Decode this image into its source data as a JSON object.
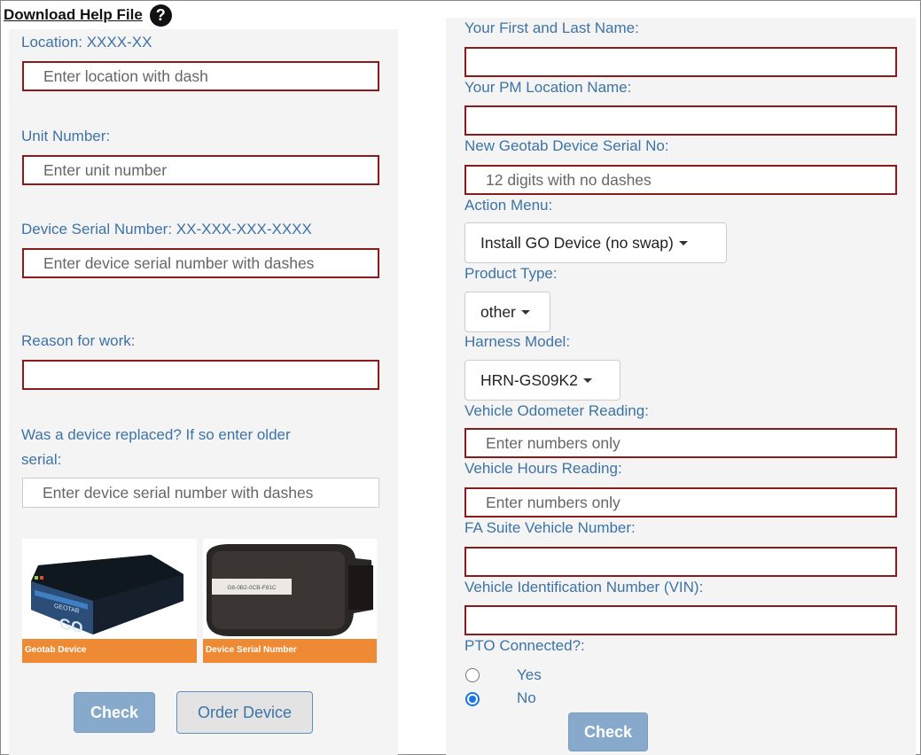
{
  "help": {
    "link_text": "Download Help File",
    "icon_glyph": "?"
  },
  "left": {
    "location_label": "Location: XXXX-XX",
    "location_placeholder": "Enter location with dash",
    "unit_label": "Unit Number:",
    "unit_placeholder": "Enter unit number",
    "serial_label": "Device Serial Number: XX-XXX-XXX-XXXX",
    "serial_placeholder": "Enter device serial number with dashes",
    "reason_label": "Reason for work:",
    "replaced_label_1": "Was a device replaced? If so enter older",
    "replaced_label_2": "serial:",
    "replaced_placeholder": "Enter device serial number with dashes",
    "image1_caption": "Geotab Device",
    "image1_brand": "GEOTAB",
    "image1_model": "GO",
    "image2_caption": "Device Serial Number",
    "image2_serial": "G8-0B2-0CB-F81C",
    "check_button": "Check",
    "order_button": "Order Device"
  },
  "right": {
    "name_label": "Your First and Last Name:",
    "pm_label": "Your PM Location Name:",
    "new_serial_label": "New Geotab Device Serial No:",
    "new_serial_placeholder": "12 digits with no dashes",
    "action_label": "Action Menu:",
    "action_value": "Install GO Device (no swap)",
    "product_label": "Product Type:",
    "product_value": "other",
    "harness_label": "Harness Model:",
    "harness_value": "HRN-GS09K2",
    "odometer_label": "Vehicle Odometer Reading:",
    "odometer_placeholder": "Enter numbers only",
    "hours_label": "Vehicle Hours Reading:",
    "hours_placeholder": "Enter numbers only",
    "fa_label": "FA Suite Vehicle Number:",
    "vin_label": "Vehicle Identification Number (VIN):",
    "pto_label": "PTO Connected?:",
    "pto_yes": "Yes",
    "pto_no": "No",
    "pto_selected": "No",
    "check_button": "Check"
  },
  "colors": {
    "label": "#3d73a6",
    "input_border": "#8b1a1a",
    "panel_bg": "#f4f4f4",
    "button_primary": "#86a9cc",
    "caption_bg": "#ee8a33"
  }
}
